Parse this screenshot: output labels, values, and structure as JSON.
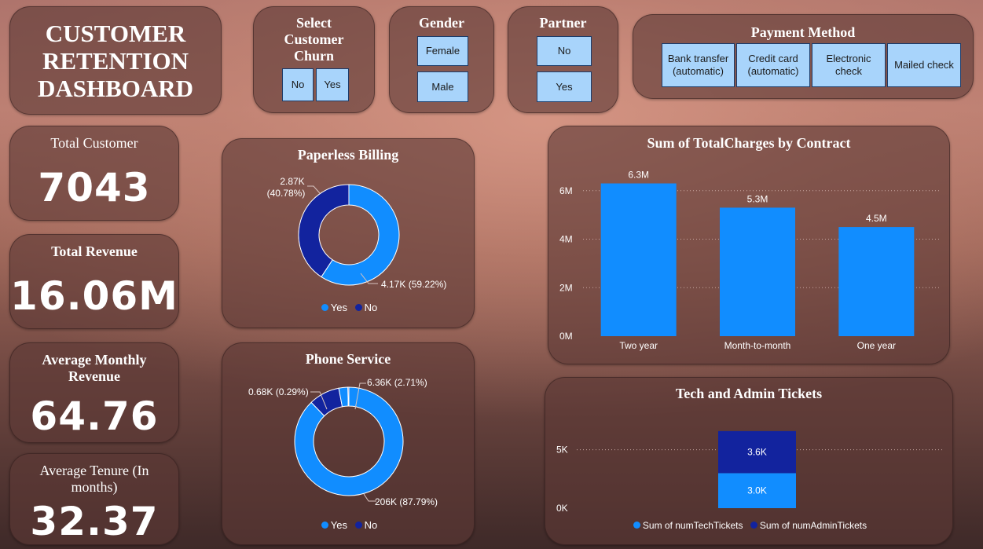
{
  "title": {
    "line1": "CUSTOMER",
    "line2": "RETENTION",
    "line3": "DASHBOARD"
  },
  "filters": {
    "churn": {
      "label_line1": "Select",
      "label_line2": "Customer",
      "label_line3": "Churn",
      "options": [
        "No",
        "Yes"
      ]
    },
    "gender": {
      "label": "Gender",
      "options": [
        "Female",
        "Male"
      ]
    },
    "partner": {
      "label": "Partner",
      "options": [
        "No",
        "Yes"
      ]
    },
    "payment": {
      "label": "Payment Method",
      "options": [
        {
          "line1": "Bank transfer",
          "line2": "(automatic)"
        },
        {
          "line1": "Credit card",
          "line2": "(automatic)"
        },
        {
          "line1": "Electronic",
          "line2": "check"
        },
        {
          "line1": "Mailed check",
          "line2": ""
        }
      ]
    }
  },
  "kpis": {
    "total_customer": {
      "label": "Total Customer",
      "value": "7043"
    },
    "total_revenue": {
      "label": "Total Revenue",
      "value": "16.06M"
    },
    "avg_monthly_revenue": {
      "label_line1": "Average Monthly",
      "label_line2": "Revenue",
      "value": "64.76"
    },
    "avg_tenure": {
      "label_line1": "Average Tenure (In",
      "label_line2": "months)",
      "value": "32.37"
    }
  },
  "colors": {
    "yes": "#118dff",
    "no": "#12239e",
    "button_bg": "#a8d4fb"
  },
  "chart_data": [
    {
      "type": "pie",
      "title": "Paperless Billing",
      "donut": true,
      "slices": [
        {
          "name": "Yes",
          "value": 4170,
          "label": "4.17K (59.22%)"
        },
        {
          "name": "No",
          "value": 2870,
          "label_line1": "2.87K",
          "label_line2": "(40.78%)"
        }
      ],
      "legend": [
        "Yes",
        "No"
      ],
      "legend_position": "bottom"
    },
    {
      "type": "pie",
      "title": "Phone Service",
      "donut": true,
      "slices": [
        {
          "name": "Yes",
          "value": 87.79,
          "label": "206K (87.79%)"
        },
        {
          "name": "No",
          "value": 9.21,
          "label": "0.68K (0.29%)"
        },
        {
          "name": "Yes",
          "value": 2.71,
          "label": "6.36K (2.71%)"
        },
        {
          "name": "No",
          "value": 0.29,
          "label": ""
        }
      ],
      "legend": [
        "Yes",
        "No"
      ],
      "legend_position": "bottom"
    },
    {
      "type": "bar",
      "title": "Sum of TotalCharges by Contract",
      "categories": [
        "Two year",
        "Month-to-month",
        "One year"
      ],
      "values": [
        6.3,
        5.3,
        4.5
      ],
      "value_labels": [
        "6.3M",
        "5.3M",
        "4.5M"
      ],
      "y_ticks": [
        0,
        2,
        4,
        6
      ],
      "y_tick_labels": [
        "0M",
        "2M",
        "4M",
        "6M"
      ],
      "ylim": [
        0,
        6.9
      ],
      "grid": true
    },
    {
      "type": "bar",
      "stacked": true,
      "title": "Tech and Admin Tickets",
      "categories": [
        ""
      ],
      "series": [
        {
          "name": "Sum of numTechTickets",
          "values": [
            3.0
          ],
          "label": "3.0K"
        },
        {
          "name": "Sum of numAdminTickets",
          "values": [
            3.6
          ],
          "label": "3.6K"
        }
      ],
      "y_ticks": [
        0,
        5
      ],
      "y_tick_labels": [
        "0K",
        "5K"
      ],
      "ylim": [
        0,
        7.8
      ],
      "grid": true,
      "legend_position": "bottom"
    }
  ]
}
